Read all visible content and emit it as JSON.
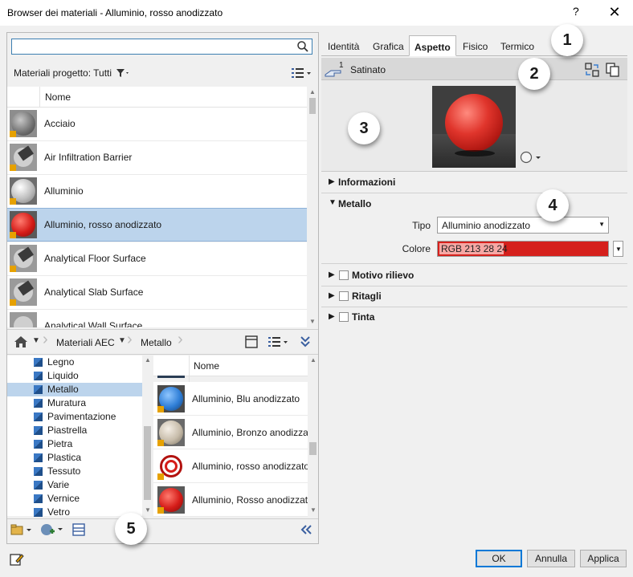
{
  "window": {
    "title": "Browser dei materiali - Alluminio, rosso anodizzato",
    "help_label": "?",
    "close_label": "✕"
  },
  "search": {
    "value": "",
    "placeholder": ""
  },
  "project": {
    "filter_label": "Materiali progetto: Tutti",
    "column_header": "Nome",
    "rows": [
      {
        "label": "Acciaio",
        "thumb": "gray-sphere"
      },
      {
        "label": "Air Infiltration Barrier",
        "thumb": "analytical-icon"
      },
      {
        "label": "Alluminio",
        "thumb": "silver-sphere"
      },
      {
        "label": "Alluminio, rosso anodizzato",
        "thumb": "red-sphere",
        "selected": true
      },
      {
        "label": "Analytical Floor Surface",
        "thumb": "analytical-icon"
      },
      {
        "label": "Analytical Slab Surface",
        "thumb": "analytical-icon"
      },
      {
        "label": "Analytical Wall Surface",
        "thumb": "analytical-icon"
      }
    ]
  },
  "library": {
    "breadcrumb": [
      "Materiali AEC",
      "Metallo"
    ],
    "tree": [
      "Legno",
      "Liquido",
      "Metallo",
      "Muratura",
      "Pavimentazione",
      "Piastrella",
      "Pietra",
      "Plastica",
      "Tessuto",
      "Varie",
      "Vernice",
      "Vetro"
    ],
    "tree_selected": "Metallo",
    "column_header": "Nome",
    "rows": [
      {
        "label": "Alluminio, Blu anodizzato",
        "thumb": "blue-sphere"
      },
      {
        "label": "Alluminio, Bronzo anodizzato",
        "thumb": "bronze-sphere"
      },
      {
        "label": "Alluminio, rosso anodizzato",
        "thumb": "red-rings"
      },
      {
        "label": "Alluminio, Rosso anodizzato",
        "thumb": "red-sphere"
      }
    ]
  },
  "tabs": [
    "Identità",
    "Grafica",
    "Aspetto",
    "Fisico",
    "Termico"
  ],
  "active_tab": "Aspetto",
  "asset": {
    "count": "1",
    "name": "Satinato"
  },
  "sections": {
    "informazioni": "Informazioni",
    "metallo": "Metallo",
    "motivo": "Motivo rilievo",
    "ritagli": "Ritagli",
    "tinta": "Tinta"
  },
  "properties": {
    "tipo_label": "Tipo",
    "tipo_value": "Alluminio anodizzato",
    "colore_label": "Colore",
    "colore_value": "RGB 213 28 24",
    "colore_hex": "#d51c18"
  },
  "buttons": {
    "ok": "OK",
    "cancel": "Annulla",
    "apply": "Applica"
  },
  "callouts": [
    "1",
    "2",
    "3",
    "4",
    "5"
  ]
}
